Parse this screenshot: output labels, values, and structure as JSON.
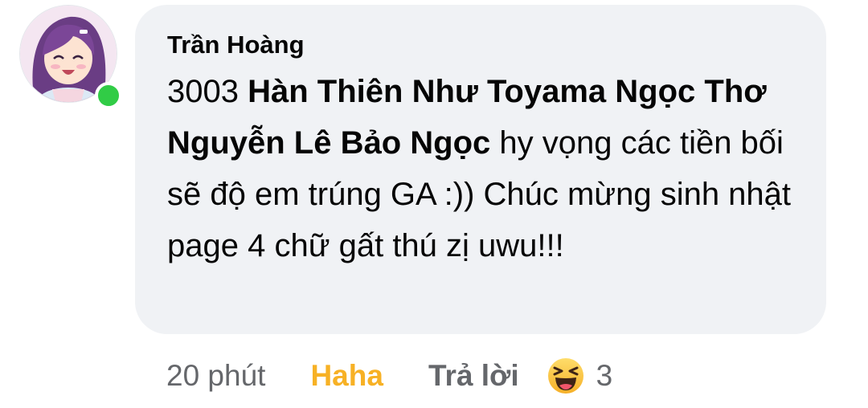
{
  "comment": {
    "author": "Trần Hoàng",
    "text_segments": [
      {
        "text": "3003 ",
        "bold": false
      },
      {
        "text": "Hàn Thiên Như Toyama Ngọc Thơ Nguyễn Lê Bảo Ngọc",
        "bold": true
      },
      {
        "text": " hy vọng các tiền bối sẽ độ em trúng GA :)) Chúc mừng sinh nhật page 4 chữ gất thú zị uwu!!!",
        "bold": false
      }
    ],
    "online": true
  },
  "actions": {
    "time": "20 phút",
    "reaction": "Haha",
    "reply": "Trả lời",
    "reaction_count": "3",
    "reaction_icon": "haha-emoji-icon"
  },
  "colors": {
    "bubble": "#f0f2f5",
    "haha": "#f7b125",
    "secondary_text": "#65676b",
    "online": "#31cc46"
  }
}
